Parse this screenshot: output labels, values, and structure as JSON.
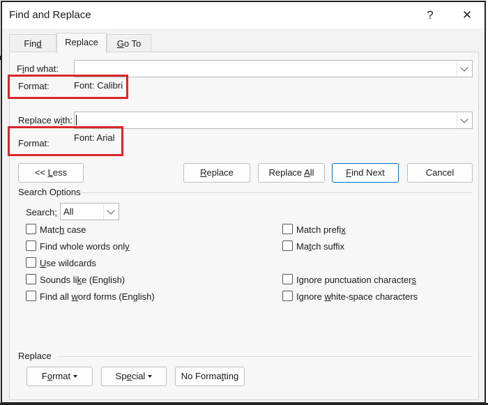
{
  "window": {
    "title": "Find and Replace",
    "help_glyph": "?",
    "close_glyph": "✕"
  },
  "tabs": [
    {
      "label_pre": "Fin",
      "label_key": "d",
      "label_post": ""
    },
    {
      "label_pre": "Replace",
      "label_key": "",
      "label_post": ""
    },
    {
      "label_pre": "",
      "label_key": "G",
      "label_post": "o To"
    }
  ],
  "find": {
    "label_pre": "F",
    "label_key": "i",
    "label_post": "nd what:",
    "value": "",
    "format_label": "Format:",
    "format_value": "Font: Calibri"
  },
  "replace": {
    "label_pre": "Replace w",
    "label_key": "i",
    "label_post": "th:",
    "value": "",
    "format_label": "Format:",
    "format_value": "Font: Arial"
  },
  "buttons": {
    "less_pre": "<< ",
    "less_key": "L",
    "less_post": "ess",
    "replace_pre": "",
    "replace_key": "R",
    "replace_post": "eplace",
    "replace_all_pre": "Replace ",
    "replace_all_key": "A",
    "replace_all_post": "ll",
    "find_next_pre": "",
    "find_next_key": "F",
    "find_next_post": "ind Next",
    "cancel": "Cancel"
  },
  "search_options": {
    "heading": "Search Options",
    "search_label_pre": "Search",
    "search_label_key": ";",
    "search_label_post": "",
    "search_value": "All",
    "left": [
      {
        "pre": "Matc",
        "key": "h",
        "post": " case"
      },
      {
        "pre": "Find whole words onl",
        "key": "y",
        "post": ""
      },
      {
        "pre": "",
        "key": "U",
        "post": "se wildcards"
      },
      {
        "pre": "Sounds li",
        "key": "k",
        "post": "e (English)"
      },
      {
        "pre": "Find all ",
        "key": "w",
        "post": "ord forms (English)"
      }
    ],
    "right": [
      {
        "pre": "Match prefi",
        "key": "x",
        "post": ""
      },
      {
        "pre": "Ma",
        "key": "t",
        "post": "ch suffix"
      },
      {
        "pre": "Ignore punctuation character",
        "key": "s",
        "post": ""
      },
      {
        "pre": "Ignore ",
        "key": "w",
        "post": "hite-space characters"
      }
    ]
  },
  "replace_section": {
    "heading": "Replace",
    "format_pre": "F",
    "format_key": "o",
    "format_post": "rmat",
    "special_pre": "Sp",
    "special_key": "e",
    "special_post": "cial",
    "no_format_pre": "No Forma",
    "no_format_key": "t",
    "no_format_post": "ting"
  }
}
